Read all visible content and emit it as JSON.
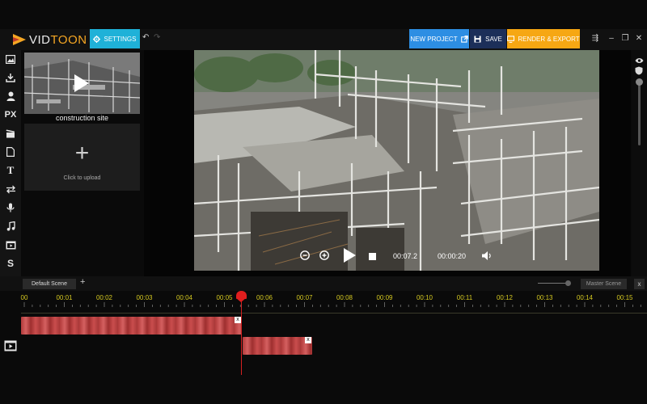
{
  "app": {
    "logo_prefix": "VID",
    "logo_suffix": "TOON"
  },
  "toolbar": {
    "settings_label": "SETTINGS",
    "new_project_label": "NEW PROJECT",
    "save_label": "SAVE",
    "render_label": "RENDER & EXPORT"
  },
  "sidebar": {
    "tools": [
      {
        "name": "image-icon"
      },
      {
        "name": "download-icon"
      },
      {
        "name": "user-icon"
      },
      {
        "name": "px-icon",
        "text": "PX"
      },
      {
        "name": "clapper-icon"
      },
      {
        "name": "document-icon"
      },
      {
        "name": "text-icon",
        "text": "T"
      },
      {
        "name": "transition-icon"
      },
      {
        "name": "microphone-icon"
      },
      {
        "name": "music-icon"
      },
      {
        "name": "video-clip-icon"
      },
      {
        "name": "s-icon",
        "text": "S"
      }
    ]
  },
  "media": {
    "thumbnail_label": "construction site",
    "upload_label": "Click to upload",
    "upload_plus": "+"
  },
  "player": {
    "current_time": "00:07.2",
    "total_time": "00:00:20"
  },
  "scene": {
    "tab_label": "Default Scene",
    "add_label": "+",
    "master_label": "Master Scene",
    "close_label": "x"
  },
  "timeline": {
    "ruler": [
      "00",
      "00:01",
      "00:02",
      "00:03",
      "00:04",
      "00:05",
      "00:06",
      "00:07",
      "00:08",
      "00:09",
      "00:10",
      "00:11",
      "00:12",
      "00:13",
      "00:14",
      "00:15"
    ],
    "clip_close": "x"
  },
  "colors": {
    "settings": "#1fb1d8",
    "new_project": "#2d8ee3",
    "save": "#1c2f59",
    "render": "#f6a713",
    "playhead": "#e01e1e",
    "ruler_text": "#d4c820",
    "clip": "#b23b3b"
  }
}
